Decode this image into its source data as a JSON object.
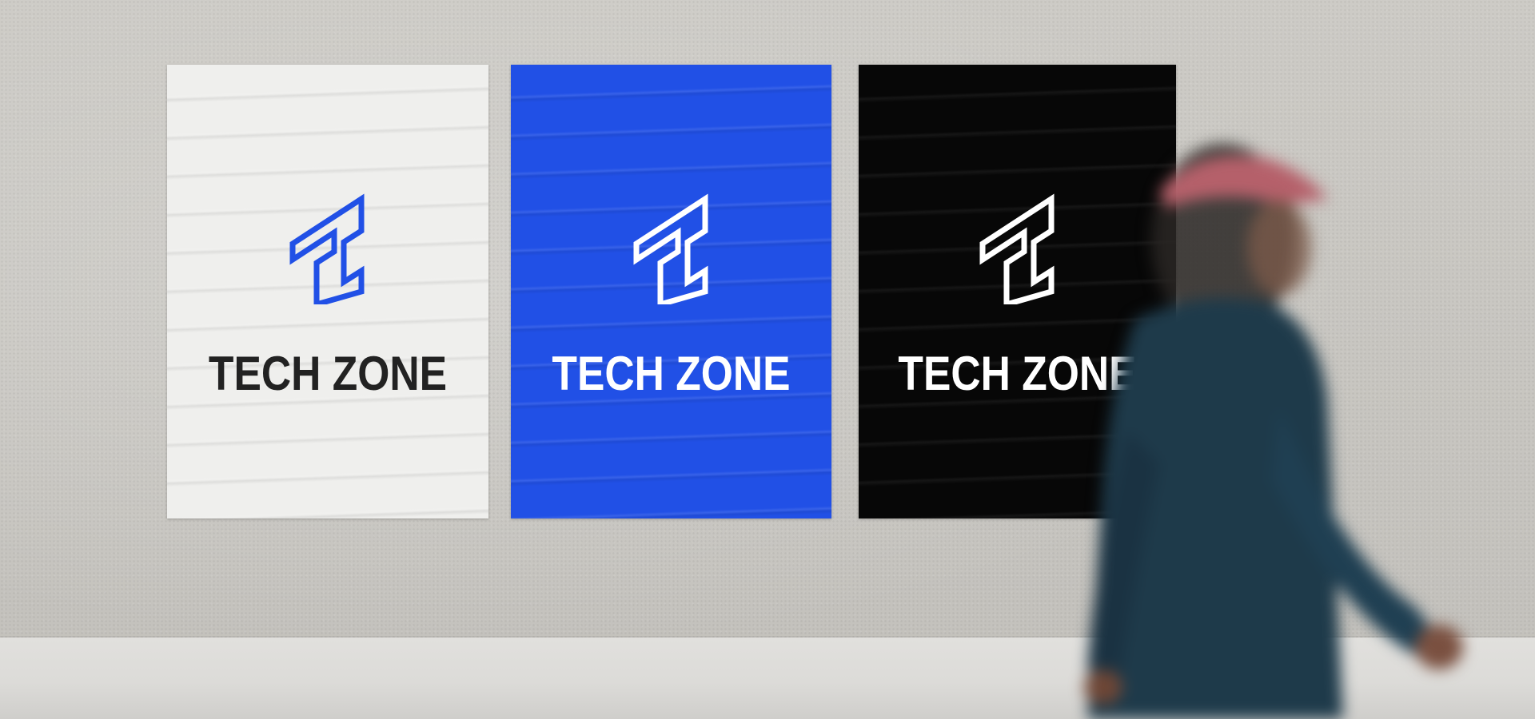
{
  "posters": [
    {
      "id": "white",
      "wordmark": "TECH ZONE",
      "background": "#efefed",
      "mark_color": "#2150e6",
      "text_color": "#222222"
    },
    {
      "id": "blue",
      "wordmark": "TECH ZONE",
      "background": "#2150e6",
      "mark_color": "#ffffff",
      "text_color": "#ffffff"
    },
    {
      "id": "black",
      "wordmark": "TECH ZONE",
      "background": "#070707",
      "mark_color": "#ffffff",
      "text_color": "#ffffff"
    }
  ],
  "colors": {
    "wall": "#c9c7c2",
    "ledge": "#dcdbd8",
    "cap": "#b5606a",
    "jacket": "#1e3a4a"
  }
}
